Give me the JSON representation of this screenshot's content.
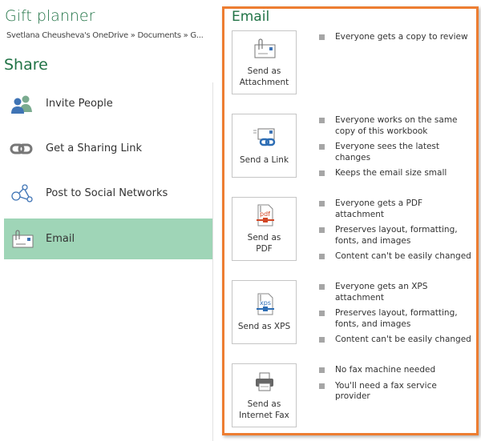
{
  "header": {
    "title": "Gift planner",
    "breadcrumb": "Svetlana Cheusheva's OneDrive » Documents » G..."
  },
  "share": {
    "heading": "Share",
    "items": [
      {
        "label": "Invite People",
        "icon": "invite-people-icon"
      },
      {
        "label": "Get a Sharing Link",
        "icon": "link-icon"
      },
      {
        "label": "Post to Social Networks",
        "icon": "social-network-icon"
      },
      {
        "label": "Email",
        "icon": "email-icon",
        "selected": true
      }
    ]
  },
  "email": {
    "heading": "Email",
    "options": [
      {
        "label": "Send as\nAttachment",
        "icon": "attachment-envelope-icon",
        "bullets": [
          "Everyone gets a copy to review"
        ]
      },
      {
        "label": "Send a Link",
        "icon": "link-envelope-icon",
        "bullets": [
          "Everyone works on the same copy of this workbook",
          "Everyone sees the latest changes",
          "Keeps the email size small"
        ]
      },
      {
        "label": "Send as\nPDF",
        "icon": "pdf-icon",
        "bullets": [
          "Everyone gets a PDF attachment",
          "Preserves layout, formatting, fonts, and images",
          "Content can't be easily changed"
        ]
      },
      {
        "label": "Send as XPS",
        "icon": "xps-icon",
        "bullets": [
          "Everyone gets an XPS attachment",
          "Preserves layout, formatting, fonts, and images",
          "Content can't be easily changed"
        ]
      },
      {
        "label": "Send as\nInternet Fax",
        "icon": "fax-icon",
        "bullets": [
          "No fax machine needed",
          "You'll need a fax service provider"
        ]
      }
    ]
  },
  "colors": {
    "accent": "#217346",
    "selected": "#9fd5b7",
    "highlight_border": "#ed7d31"
  }
}
